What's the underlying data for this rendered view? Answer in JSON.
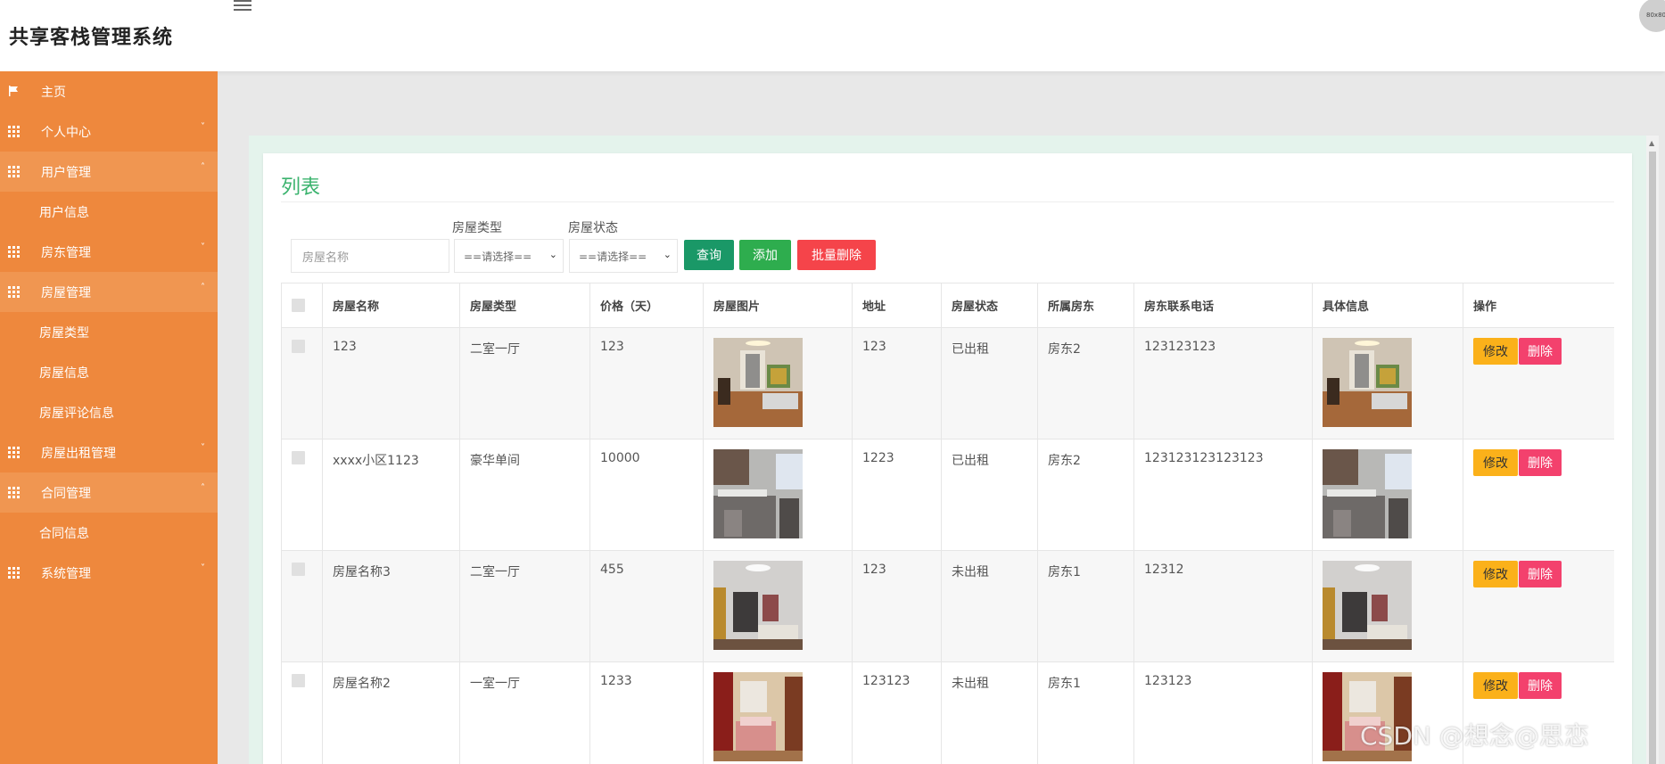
{
  "header": {
    "app_title": "共享客栈管理系统",
    "avatar_text": "80x80"
  },
  "sidebar": {
    "items": [
      {
        "label": "主页",
        "icon": "flag-icon",
        "type": "item",
        "arrow": ""
      },
      {
        "label": "个人中心",
        "icon": "grid-icon",
        "type": "group",
        "arrow": "˅"
      },
      {
        "label": "用户管理",
        "icon": "grid-icon",
        "type": "group-open",
        "arrow": "˄"
      },
      {
        "label": "用户信息",
        "icon": "",
        "type": "sub",
        "arrow": ""
      },
      {
        "label": "房东管理",
        "icon": "grid-icon",
        "type": "group",
        "arrow": "˅"
      },
      {
        "label": "房屋管理",
        "icon": "grid-icon",
        "type": "group-open",
        "arrow": "˄"
      },
      {
        "label": "房屋类型",
        "icon": "",
        "type": "sub",
        "arrow": ""
      },
      {
        "label": "房屋信息",
        "icon": "",
        "type": "sub",
        "arrow": ""
      },
      {
        "label": "房屋评论信息",
        "icon": "",
        "type": "sub",
        "arrow": ""
      },
      {
        "label": "房屋出租管理",
        "icon": "grid-icon",
        "type": "group",
        "arrow": "˅"
      },
      {
        "label": "合同管理",
        "icon": "grid-icon",
        "type": "group-open",
        "arrow": "˄"
      },
      {
        "label": "合同信息",
        "icon": "",
        "type": "sub",
        "arrow": ""
      },
      {
        "label": "系统管理",
        "icon": "grid-icon",
        "type": "group",
        "arrow": "˅"
      }
    ]
  },
  "main": {
    "card_title": "列表",
    "filters": {
      "name_placeholder": "房屋名称",
      "type_label": "房屋类型",
      "type_selected": "==请选择==",
      "status_label": "房屋状态",
      "status_selected": "==请选择=="
    },
    "buttons": {
      "query": "查询",
      "add": "添加",
      "batch_delete": "批量删除"
    },
    "table": {
      "columns": [
        "房屋名称",
        "房屋类型",
        "价格（天）",
        "房屋图片",
        "地址",
        "房屋状态",
        "所属房东",
        "房东联系电话",
        "具体信息",
        "操作"
      ],
      "rows": [
        {
          "name": "123",
          "type": "二室一厅",
          "price": "123",
          "address": "123",
          "status": "已出租",
          "landlord": "房东2",
          "phone": "123123123",
          "photo_theme": "living-room"
        },
        {
          "name": "xxxx小区1123",
          "type": "豪华单间",
          "price": "10000",
          "address": "1223",
          "status": "已出租",
          "landlord": "房东2",
          "phone": "123123123123123",
          "photo_theme": "kitchen"
        },
        {
          "name": "房屋名称3",
          "type": "二室一厅",
          "price": "455",
          "address": "123",
          "status": "未出租",
          "landlord": "房东1",
          "phone": "12312",
          "photo_theme": "dining-room"
        },
        {
          "name": "房屋名称2",
          "type": "一室一厅",
          "price": "1233",
          "address": "123123",
          "status": "未出租",
          "landlord": "房东1",
          "phone": "123123",
          "photo_theme": "bedroom"
        }
      ],
      "edit_label": "修改",
      "delete_label": "删除"
    }
  },
  "watermark": "CSDN @想念@思恋",
  "colors": {
    "sidebar": "#ee883d",
    "accent_green": "#3bb36e",
    "query_btn": "#1a9867",
    "add_btn": "#2ead4e",
    "batch_delete_btn": "#f5444a",
    "edit_btn": "#fbb11a",
    "delete_btn": "#f3416d"
  }
}
